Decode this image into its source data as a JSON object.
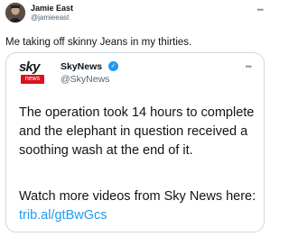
{
  "tweet": {
    "author_name": "Jamie East",
    "verified_badge": "✓",
    "author_handle": "@jamieeast",
    "more_icon": "more-icon",
    "more_glyph": "•••",
    "text": "Me taking off skinny Jeans in my thirties."
  },
  "quoted_tweet": {
    "logo_wordmark": "sky",
    "logo_subtext": "news",
    "author_name": "SkyNews",
    "author_handle": "@SkyNews",
    "more_glyph": "•••",
    "body": "The operation took 14 hours to complete and the elephant in question received a soothing wash at the end of it.",
    "cta_text": "Watch more videos from Sky News here:",
    "cta_link": "trib.al/gtBwGcs"
  },
  "colors": {
    "accent": "#1d9bf0",
    "brand_red": "#d8141f",
    "border": "#cfd9de",
    "muted": "#536471"
  }
}
